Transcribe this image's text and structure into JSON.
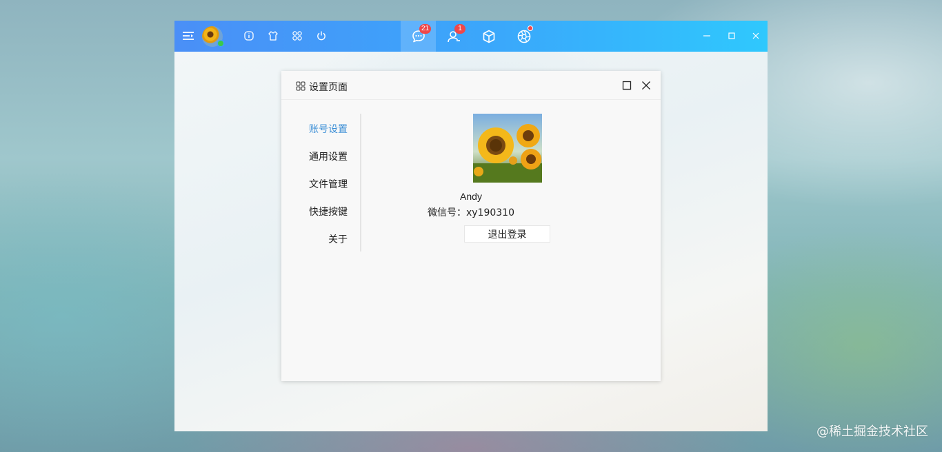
{
  "topbar": {
    "message_badge": "21",
    "contacts_badge": "1"
  },
  "dialog": {
    "title": "设置页面",
    "menu": [
      {
        "label": "账号设置"
      },
      {
        "label": "通用设置"
      },
      {
        "label": "文件管理"
      },
      {
        "label": "快捷按键"
      },
      {
        "label": "关于"
      }
    ],
    "account": {
      "name": "Andy",
      "wechat_label": "微信号：",
      "wechat_id": "xy190310",
      "logout_label": "退出登录"
    }
  },
  "watermark": "@稀土掘金技术社区",
  "colors": {
    "topbar_start": "#4a8ff7",
    "topbar_end": "#2fc8fd",
    "active_menu": "#3d8fd6",
    "badge": "#f0474a",
    "online": "#3cc948"
  },
  "icons": {
    "menu": "menu-toggle-icon",
    "info": "info-icon",
    "skin": "shirt-icon",
    "apps": "apps-grid-icon",
    "power": "power-icon",
    "chat": "chat-bubble-icon",
    "contacts": "contacts-icon",
    "box": "cube-icon",
    "moments": "aperture-icon"
  }
}
